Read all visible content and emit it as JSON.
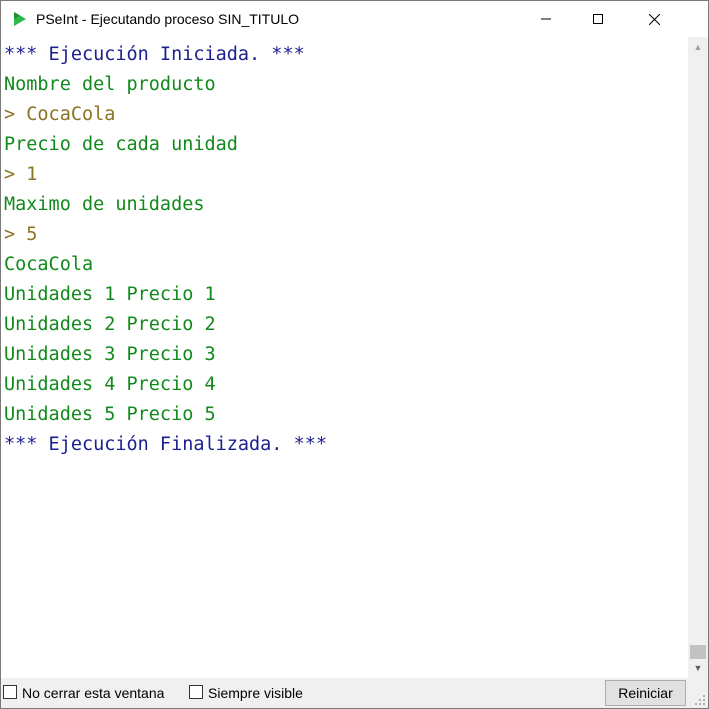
{
  "window": {
    "title": "PSeInt - Ejecutando proceso SIN_TITULO",
    "minimize_glyph": "—",
    "maximize_glyph": "☐",
    "close_glyph": "✕"
  },
  "console": {
    "lines": [
      {
        "text": "*** Ejecución Iniciada. ***",
        "kind": "status"
      },
      {
        "text": "Nombre del producto",
        "kind": "output"
      },
      {
        "text": "> CocaCola",
        "kind": "input"
      },
      {
        "text": "Precio de cada unidad",
        "kind": "output"
      },
      {
        "text": "> 1",
        "kind": "input"
      },
      {
        "text": "Maximo de unidades",
        "kind": "output"
      },
      {
        "text": "> 5",
        "kind": "input"
      },
      {
        "text": "CocaCola",
        "kind": "output"
      },
      {
        "text": "Unidades 1 Precio 1",
        "kind": "output"
      },
      {
        "text": "Unidades 2 Precio 2",
        "kind": "output"
      },
      {
        "text": "Unidades 3 Precio 3",
        "kind": "output"
      },
      {
        "text": "Unidades 4 Precio 4",
        "kind": "output"
      },
      {
        "text": "Unidades 5 Precio 5",
        "kind": "output"
      },
      {
        "text": "*** Ejecución Finalizada. ***",
        "kind": "status"
      }
    ]
  },
  "bottom": {
    "no_close_label": "No cerrar esta ventana",
    "no_close_checked": false,
    "always_visible_label": "Siempre visible",
    "always_visible_checked": false,
    "restart_label": "Reiniciar"
  },
  "colors": {
    "status": "#1c1f8f",
    "output": "#118a1b",
    "input": "#8a7322",
    "app_icon": "#2fb84a"
  }
}
